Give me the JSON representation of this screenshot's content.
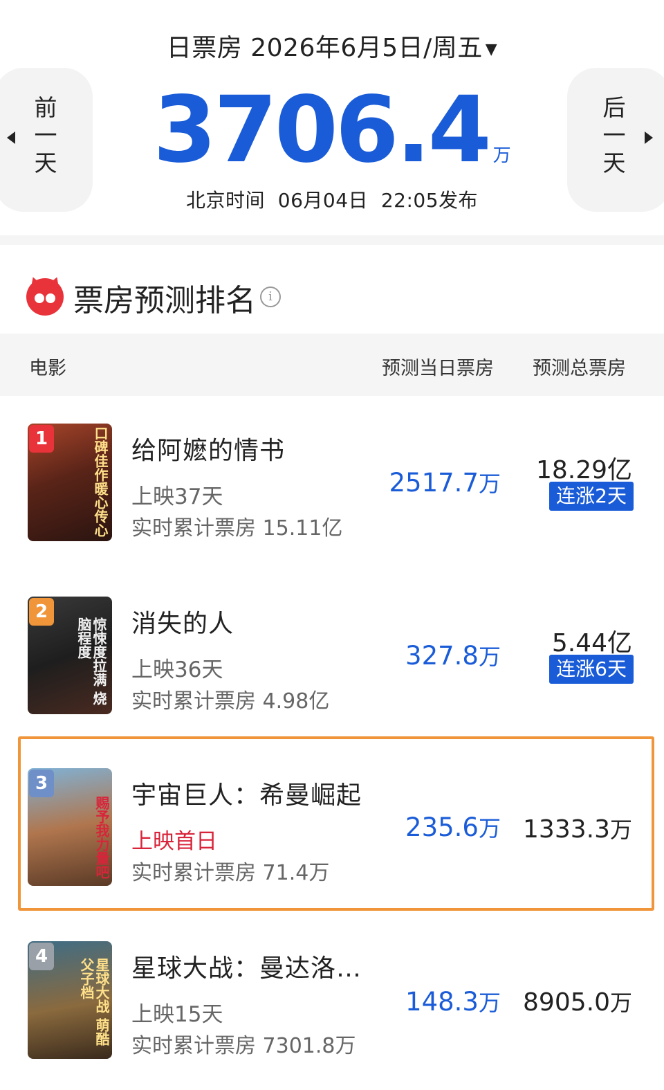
{
  "header": {
    "date_label": "日票房 2026年6月5日/周五",
    "prev_label": [
      "前",
      "一",
      "天"
    ],
    "next_label": [
      "后",
      "一",
      "天"
    ],
    "total_value": "3706.4",
    "total_unit": "万",
    "publish_text": "北京时间  06月04日  22:05发布"
  },
  "section": {
    "title": "票房预测排名",
    "info_icon": "i"
  },
  "table": {
    "col_movie": "电影",
    "col_day": "预测当日票房",
    "col_total": "预测总票房"
  },
  "colors": {
    "accent_blue": "#1a5cd8",
    "highlight_orange": "#f0953a",
    "first_day_red": "#d8243a"
  },
  "movies": [
    {
      "rank": "1",
      "title": "给阿嬷的情书",
      "days": "上映37天",
      "cumulative": "实时累计票房 15.11亿",
      "day_value": "2517.7",
      "day_unit": "万",
      "total_value": "18.29亿",
      "badge": "连涨2天",
      "poster_text": "口碑佳作暖心传心"
    },
    {
      "rank": "2",
      "title": "消失的人",
      "days": "上映36天",
      "cumulative": "实时累计票房 4.98亿",
      "day_value": "327.8",
      "day_unit": "万",
      "total_value": "5.44亿",
      "badge": "连涨6天",
      "poster_text": "惊悚度拉满 烧脑程度"
    },
    {
      "rank": "3",
      "title": "宇宙巨人：希曼崛起",
      "days": "上映首日",
      "cumulative": "实时累计票房 71.4万",
      "day_value": "235.6",
      "day_unit": "万",
      "total_value": "1333.3",
      "total_unit": "万",
      "poster_text": "赐予我力量吧"
    },
    {
      "rank": "4",
      "title": "星球大战：曼达洛…",
      "days": "上映15天",
      "cumulative": "实时累计票房 7301.8万",
      "day_value": "148.3",
      "day_unit": "万",
      "total_value": "8905.0",
      "total_unit": "万",
      "poster_text": "星球大战 萌酷父子档"
    }
  ]
}
